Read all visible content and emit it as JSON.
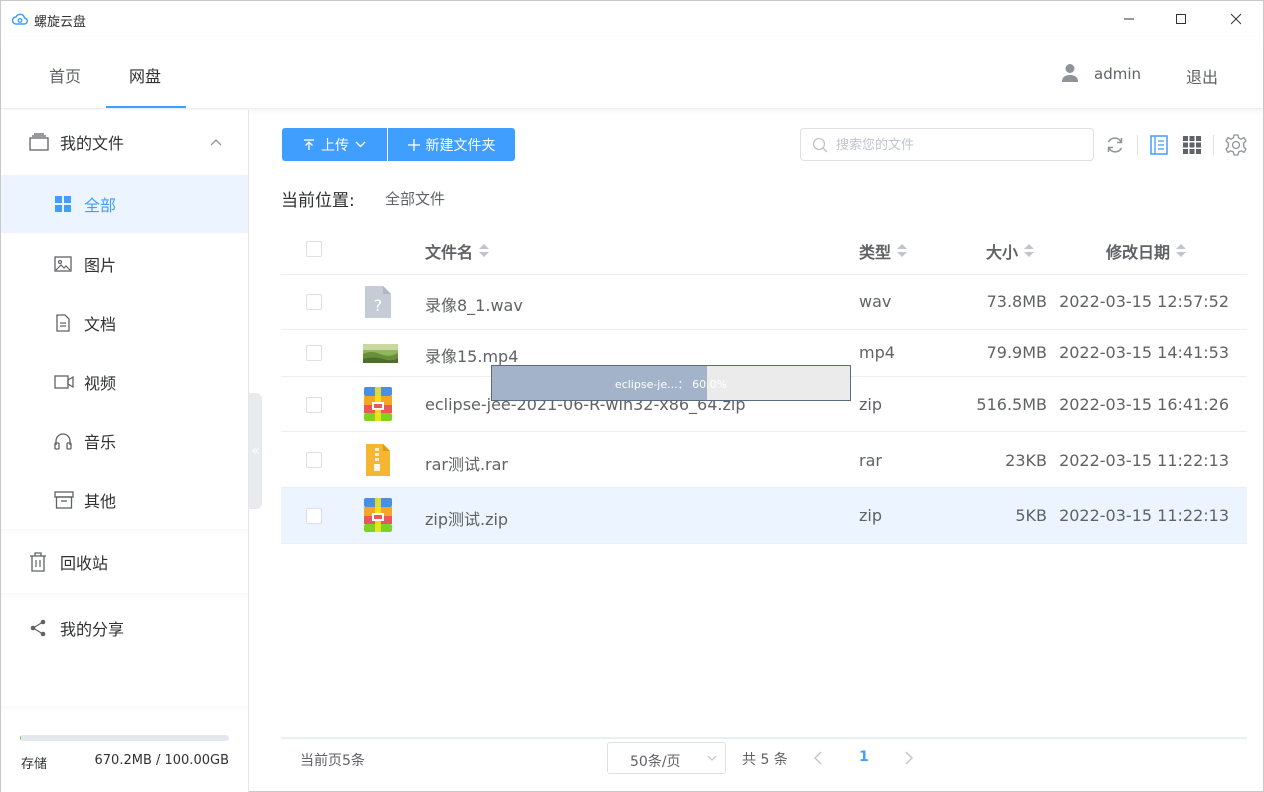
{
  "window": {
    "title": "螺旋云盘"
  },
  "topnav": {
    "tabs": [
      {
        "label": "首页"
      },
      {
        "label": "网盘"
      }
    ],
    "user": "admin",
    "logout": "退出"
  },
  "sidebar": {
    "my_files": "我的文件",
    "items": [
      {
        "label": "全部",
        "icon": "grid-icon"
      },
      {
        "label": "图片",
        "icon": "image-icon"
      },
      {
        "label": "文档",
        "icon": "document-icon"
      },
      {
        "label": "视频",
        "icon": "video-icon"
      },
      {
        "label": "音乐",
        "icon": "headphones-icon"
      },
      {
        "label": "其他",
        "icon": "archive-icon"
      }
    ],
    "recycle": "回收站",
    "share": "我的分享",
    "storage": {
      "label": "存储",
      "value": "670.2MB / 100.00GB",
      "used_fraction": 0.0067
    }
  },
  "toolbar": {
    "upload_label": "上传",
    "new_folder_label": "新建文件夹",
    "search_placeholder": "搜索您的文件"
  },
  "breadcrumb": {
    "label": "当前位置:",
    "value": "全部文件"
  },
  "table": {
    "headers": {
      "name": "文件名",
      "type": "类型",
      "size": "大小",
      "date": "修改日期"
    },
    "rows": [
      {
        "name": "录像8_1.wav",
        "type": "wav",
        "size": "73.8MB",
        "date": "2022-03-15 12:57:52",
        "icon": "unknown-file-icon"
      },
      {
        "name": "录像15.mp4",
        "type": "mp4",
        "size": "79.9MB",
        "date": "2022-03-15 14:41:53",
        "icon": "video-thumbnail"
      },
      {
        "name": "eclipse-jee-2021-06-R-win32-x86_64.zip",
        "type": "zip",
        "size": "516.5MB",
        "date": "2022-03-15 16:41:26",
        "icon": "zip-icon"
      },
      {
        "name": "rar测试.rar",
        "type": "rar",
        "size": "23KB",
        "date": "2022-03-15 11:22:13",
        "icon": "rar-icon"
      },
      {
        "name": "zip测试.zip",
        "type": "zip",
        "size": "5KB",
        "date": "2022-03-15 11:22:13",
        "icon": "zip-icon"
      }
    ]
  },
  "upload_progress": {
    "text": "eclipse-je...： 60.0%",
    "fraction": 0.6
  },
  "pagination": {
    "page_count_text": "当前页5条",
    "page_size": "50条/页",
    "total": "共 5 条",
    "current_page": "1"
  },
  "colors": {
    "accent": "#409eff",
    "selected_row": "#ecf5ff"
  }
}
